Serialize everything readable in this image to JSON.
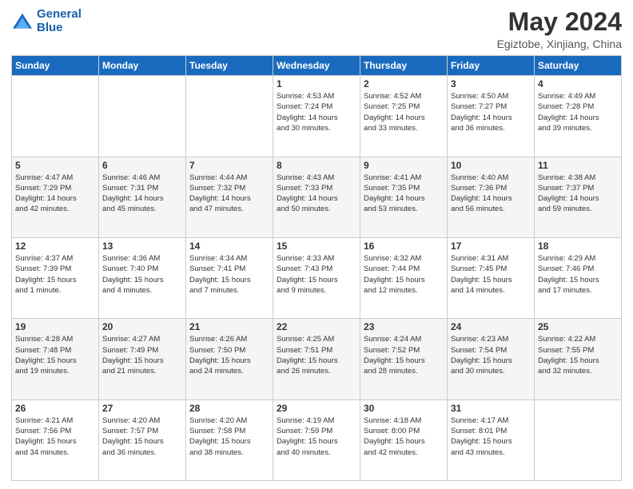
{
  "header": {
    "logo_line1": "General",
    "logo_line2": "Blue",
    "title": "May 2024",
    "subtitle": "Egiztobe, Xinjiang, China"
  },
  "weekdays": [
    "Sunday",
    "Monday",
    "Tuesday",
    "Wednesday",
    "Thursday",
    "Friday",
    "Saturday"
  ],
  "rows": [
    [
      {
        "day": "",
        "info": ""
      },
      {
        "day": "",
        "info": ""
      },
      {
        "day": "",
        "info": ""
      },
      {
        "day": "1",
        "info": "Sunrise: 4:53 AM\nSunset: 7:24 PM\nDaylight: 14 hours\nand 30 minutes."
      },
      {
        "day": "2",
        "info": "Sunrise: 4:52 AM\nSunset: 7:25 PM\nDaylight: 14 hours\nand 33 minutes."
      },
      {
        "day": "3",
        "info": "Sunrise: 4:50 AM\nSunset: 7:27 PM\nDaylight: 14 hours\nand 36 minutes."
      },
      {
        "day": "4",
        "info": "Sunrise: 4:49 AM\nSunset: 7:28 PM\nDaylight: 14 hours\nand 39 minutes."
      }
    ],
    [
      {
        "day": "5",
        "info": "Sunrise: 4:47 AM\nSunset: 7:29 PM\nDaylight: 14 hours\nand 42 minutes."
      },
      {
        "day": "6",
        "info": "Sunrise: 4:46 AM\nSunset: 7:31 PM\nDaylight: 14 hours\nand 45 minutes."
      },
      {
        "day": "7",
        "info": "Sunrise: 4:44 AM\nSunset: 7:32 PM\nDaylight: 14 hours\nand 47 minutes."
      },
      {
        "day": "8",
        "info": "Sunrise: 4:43 AM\nSunset: 7:33 PM\nDaylight: 14 hours\nand 50 minutes."
      },
      {
        "day": "9",
        "info": "Sunrise: 4:41 AM\nSunset: 7:35 PM\nDaylight: 14 hours\nand 53 minutes."
      },
      {
        "day": "10",
        "info": "Sunrise: 4:40 AM\nSunset: 7:36 PM\nDaylight: 14 hours\nand 56 minutes."
      },
      {
        "day": "11",
        "info": "Sunrise: 4:38 AM\nSunset: 7:37 PM\nDaylight: 14 hours\nand 59 minutes."
      }
    ],
    [
      {
        "day": "12",
        "info": "Sunrise: 4:37 AM\nSunset: 7:39 PM\nDaylight: 15 hours\nand 1 minute."
      },
      {
        "day": "13",
        "info": "Sunrise: 4:36 AM\nSunset: 7:40 PM\nDaylight: 15 hours\nand 4 minutes."
      },
      {
        "day": "14",
        "info": "Sunrise: 4:34 AM\nSunset: 7:41 PM\nDaylight: 15 hours\nand 7 minutes."
      },
      {
        "day": "15",
        "info": "Sunrise: 4:33 AM\nSunset: 7:43 PM\nDaylight: 15 hours\nand 9 minutes."
      },
      {
        "day": "16",
        "info": "Sunrise: 4:32 AM\nSunset: 7:44 PM\nDaylight: 15 hours\nand 12 minutes."
      },
      {
        "day": "17",
        "info": "Sunrise: 4:31 AM\nSunset: 7:45 PM\nDaylight: 15 hours\nand 14 minutes."
      },
      {
        "day": "18",
        "info": "Sunrise: 4:29 AM\nSunset: 7:46 PM\nDaylight: 15 hours\nand 17 minutes."
      }
    ],
    [
      {
        "day": "19",
        "info": "Sunrise: 4:28 AM\nSunset: 7:48 PM\nDaylight: 15 hours\nand 19 minutes."
      },
      {
        "day": "20",
        "info": "Sunrise: 4:27 AM\nSunset: 7:49 PM\nDaylight: 15 hours\nand 21 minutes."
      },
      {
        "day": "21",
        "info": "Sunrise: 4:26 AM\nSunset: 7:50 PM\nDaylight: 15 hours\nand 24 minutes."
      },
      {
        "day": "22",
        "info": "Sunrise: 4:25 AM\nSunset: 7:51 PM\nDaylight: 15 hours\nand 26 minutes."
      },
      {
        "day": "23",
        "info": "Sunrise: 4:24 AM\nSunset: 7:52 PM\nDaylight: 15 hours\nand 28 minutes."
      },
      {
        "day": "24",
        "info": "Sunrise: 4:23 AM\nSunset: 7:54 PM\nDaylight: 15 hours\nand 30 minutes."
      },
      {
        "day": "25",
        "info": "Sunrise: 4:22 AM\nSunset: 7:55 PM\nDaylight: 15 hours\nand 32 minutes."
      }
    ],
    [
      {
        "day": "26",
        "info": "Sunrise: 4:21 AM\nSunset: 7:56 PM\nDaylight: 15 hours\nand 34 minutes."
      },
      {
        "day": "27",
        "info": "Sunrise: 4:20 AM\nSunset: 7:57 PM\nDaylight: 15 hours\nand 36 minutes."
      },
      {
        "day": "28",
        "info": "Sunrise: 4:20 AM\nSunset: 7:58 PM\nDaylight: 15 hours\nand 38 minutes."
      },
      {
        "day": "29",
        "info": "Sunrise: 4:19 AM\nSunset: 7:59 PM\nDaylight: 15 hours\nand 40 minutes."
      },
      {
        "day": "30",
        "info": "Sunrise: 4:18 AM\nSunset: 8:00 PM\nDaylight: 15 hours\nand 42 minutes."
      },
      {
        "day": "31",
        "info": "Sunrise: 4:17 AM\nSunset: 8:01 PM\nDaylight: 15 hours\nand 43 minutes."
      },
      {
        "day": "",
        "info": ""
      }
    ]
  ]
}
